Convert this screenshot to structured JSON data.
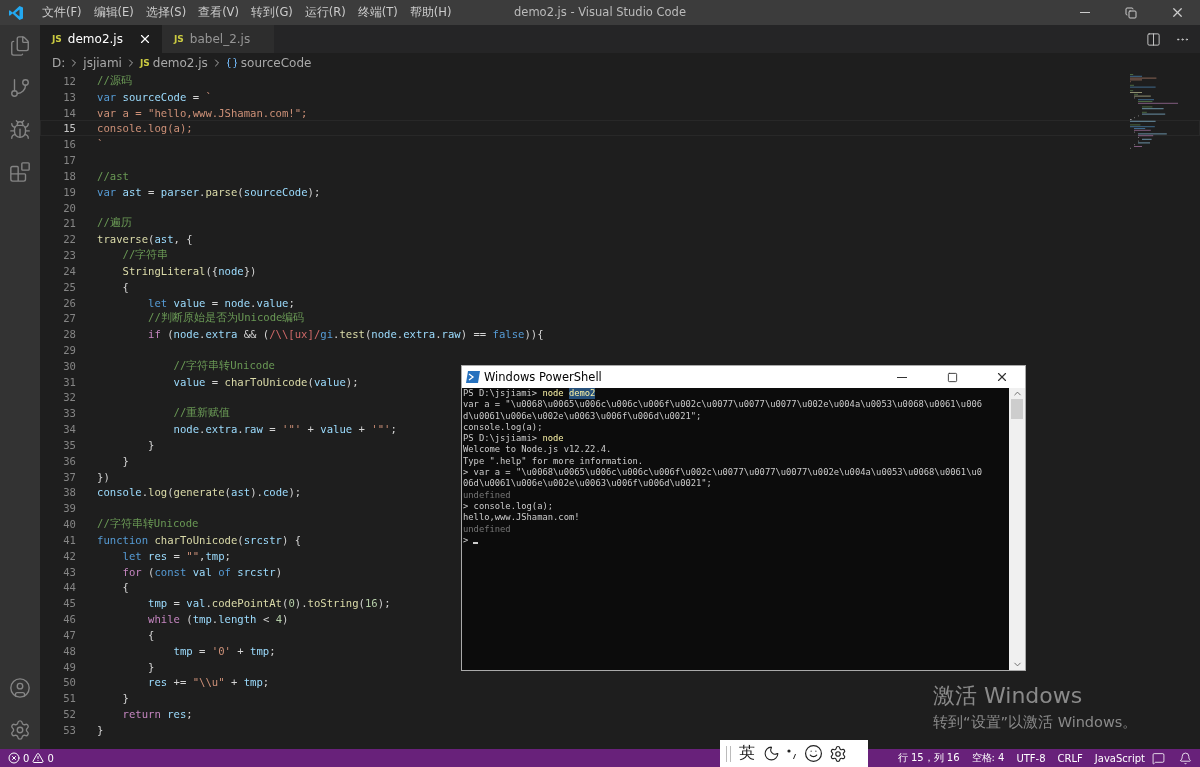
{
  "window": {
    "title": "demo2.js - Visual Studio Code"
  },
  "menu": [
    "文件(F)",
    "编辑(E)",
    "选择(S)",
    "查看(V)",
    "转到(G)",
    "运行(R)",
    "终端(T)",
    "帮助(H)"
  ],
  "tabs": [
    {
      "badge": "JS",
      "label": "demo2.js",
      "selected": true
    },
    {
      "badge": "JS",
      "label": "babel_2.js",
      "selected": false
    }
  ],
  "breadcrumb": {
    "drive": "D:",
    "folder": "jsjiami",
    "file_badge": "JS",
    "file": "demo2.js",
    "symbol": "sourceCode"
  },
  "editor": {
    "lines": [
      {
        "number": "12",
        "current": false,
        "tokens": [
          {
            "text": "//源码",
            "kind": "comment"
          }
        ]
      },
      {
        "number": "13",
        "current": false,
        "tokens": [
          {
            "text": "var",
            "kind": "keyword"
          },
          {
            "text": " sourceCode",
            "kind": "variable"
          },
          {
            "text": " = ",
            "kind": "plain"
          },
          {
            "text": "`",
            "kind": "string"
          }
        ]
      },
      {
        "number": "14",
        "current": false,
        "tokens": [
          {
            "text": "var a = \"hello,www.JShaman.com!\";",
            "kind": "string"
          }
        ]
      },
      {
        "number": "15",
        "current": true,
        "tokens": [
          {
            "text": "console.log(a);",
            "kind": "string"
          }
        ]
      },
      {
        "number": "16",
        "current": false,
        "tokens": [
          {
            "text": "`",
            "kind": "string"
          }
        ]
      },
      {
        "number": "17",
        "current": false
      },
      {
        "number": "18",
        "current": false,
        "tokens": [
          {
            "text": "//ast",
            "kind": "comment"
          }
        ]
      },
      {
        "number": "19",
        "current": false,
        "tokens": [
          {
            "text": "var",
            "kind": "keyword"
          },
          {
            "text": " ast",
            "kind": "variable"
          },
          {
            "text": " = ",
            "kind": "plain"
          },
          {
            "text": "parser",
            "kind": "variable"
          },
          {
            "text": ".",
            "kind": "plain"
          },
          {
            "text": "parse",
            "kind": "function"
          },
          {
            "text": "(",
            "kind": "plain"
          },
          {
            "text": "sourceCode",
            "kind": "variable"
          },
          {
            "text": ");",
            "kind": "plain"
          }
        ]
      },
      {
        "number": "20",
        "current": false
      },
      {
        "number": "21",
        "current": false,
        "tokens": [
          {
            "text": "//遍历",
            "kind": "comment"
          }
        ]
      },
      {
        "number": "22",
        "current": false,
        "tokens": [
          {
            "text": "traverse",
            "kind": "function"
          },
          {
            "text": "(",
            "kind": "plain"
          },
          {
            "text": "ast",
            "kind": "variable"
          },
          {
            "text": ", {",
            "kind": "plain"
          }
        ]
      },
      {
        "number": "23",
        "current": false,
        "tokens": [
          {
            "text": "    //字符串",
            "kind": "comment"
          }
        ]
      },
      {
        "number": "24",
        "current": false,
        "tokens": [
          {
            "text": "    StringLiteral",
            "kind": "function"
          },
          {
            "text": "({",
            "kind": "plain"
          },
          {
            "text": "node",
            "kind": "variable"
          },
          {
            "text": "})",
            "kind": "plain"
          }
        ]
      },
      {
        "number": "25",
        "current": false,
        "tokens": [
          {
            "text": "    {",
            "kind": "plain"
          }
        ]
      },
      {
        "number": "26",
        "current": false,
        "tokens": [
          {
            "text": "        let",
            "kind": "keyword"
          },
          {
            "text": " value",
            "kind": "variable"
          },
          {
            "text": " = ",
            "kind": "plain"
          },
          {
            "text": "node",
            "kind": "variable"
          },
          {
            "text": ".",
            "kind": "plain"
          },
          {
            "text": "value",
            "kind": "variable"
          },
          {
            "text": ";",
            "kind": "plain"
          }
        ]
      },
      {
        "number": "27",
        "current": false,
        "tokens": [
          {
            "text": "        //判断原始是否为Unicode编码",
            "kind": "comment"
          }
        ]
      },
      {
        "number": "28",
        "current": false,
        "tokens": [
          {
            "text": "        if",
            "kind": "control"
          },
          {
            "text": " (",
            "kind": "plain"
          },
          {
            "text": "node",
            "kind": "variable"
          },
          {
            "text": ".",
            "kind": "plain"
          },
          {
            "text": "extra",
            "kind": "variable"
          },
          {
            "text": " && (",
            "kind": "plain"
          },
          {
            "text": "/\\\\[ux]/",
            "kind": "regex"
          },
          {
            "text": "gi",
            "kind": "keyword"
          },
          {
            "text": ".",
            "kind": "plain"
          },
          {
            "text": "test",
            "kind": "function"
          },
          {
            "text": "(",
            "kind": "plain"
          },
          {
            "text": "node",
            "kind": "variable"
          },
          {
            "text": ".",
            "kind": "plain"
          },
          {
            "text": "extra",
            "kind": "variable"
          },
          {
            "text": ".",
            "kind": "plain"
          },
          {
            "text": "raw",
            "kind": "variable"
          },
          {
            "text": ") == ",
            "kind": "plain"
          },
          {
            "text": "false",
            "kind": "keyword"
          },
          {
            "text": ")){",
            "kind": "plain"
          }
        ]
      },
      {
        "number": "29",
        "current": false
      },
      {
        "number": "30",
        "current": false,
        "tokens": [
          {
            "text": "            //字符串转Unicode",
            "kind": "comment"
          }
        ]
      },
      {
        "number": "31",
        "current": false,
        "tokens": [
          {
            "text": "            value",
            "kind": "variable"
          },
          {
            "text": " = ",
            "kind": "plain"
          },
          {
            "text": "charToUnicode",
            "kind": "function"
          },
          {
            "text": "(",
            "kind": "plain"
          },
          {
            "text": "value",
            "kind": "variable"
          },
          {
            "text": ");",
            "kind": "plain"
          }
        ]
      },
      {
        "number": "32",
        "current": false
      },
      {
        "number": "33",
        "current": false,
        "tokens": [
          {
            "text": "            //重新赋值",
            "kind": "comment"
          }
        ]
      },
      {
        "number": "34",
        "current": false,
        "tokens": [
          {
            "text": "            node",
            "kind": "variable"
          },
          {
            "text": ".",
            "kind": "plain"
          },
          {
            "text": "extra",
            "kind": "variable"
          },
          {
            "text": ".",
            "kind": "plain"
          },
          {
            "text": "raw",
            "kind": "variable"
          },
          {
            "text": " = ",
            "kind": "plain"
          },
          {
            "text": "'\"'",
            "kind": "string"
          },
          {
            "text": " + ",
            "kind": "plain"
          },
          {
            "text": "value",
            "kind": "variable"
          },
          {
            "text": " + ",
            "kind": "plain"
          },
          {
            "text": "'\"'",
            "kind": "string"
          },
          {
            "text": ";",
            "kind": "plain"
          }
        ]
      },
      {
        "number": "35",
        "current": false,
        "tokens": [
          {
            "text": "        }",
            "kind": "plain"
          }
        ]
      },
      {
        "number": "36",
        "current": false,
        "tokens": [
          {
            "text": "    }",
            "kind": "plain"
          }
        ]
      },
      {
        "number": "37",
        "current": false,
        "tokens": [
          {
            "text": "})",
            "kind": "plain"
          }
        ]
      },
      {
        "number": "38",
        "current": false,
        "tokens": [
          {
            "text": "console",
            "kind": "variable"
          },
          {
            "text": ".",
            "kind": "plain"
          },
          {
            "text": "log",
            "kind": "function"
          },
          {
            "text": "(",
            "kind": "plain"
          },
          {
            "text": "generate",
            "kind": "function"
          },
          {
            "text": "(",
            "kind": "plain"
          },
          {
            "text": "ast",
            "kind": "variable"
          },
          {
            "text": ").",
            "kind": "plain"
          },
          {
            "text": "code",
            "kind": "variable"
          },
          {
            "text": ");",
            "kind": "plain"
          }
        ]
      },
      {
        "number": "39",
        "current": false
      },
      {
        "number": "40",
        "current": false,
        "tokens": [
          {
            "text": "//字符串转Unicode",
            "kind": "comment"
          }
        ]
      },
      {
        "number": "41",
        "current": false,
        "tokens": [
          {
            "text": "function",
            "kind": "keyword"
          },
          {
            "text": " charToUnicode",
            "kind": "function"
          },
          {
            "text": "(",
            "kind": "plain"
          },
          {
            "text": "srcstr",
            "kind": "variable"
          },
          {
            "text": ") {",
            "kind": "plain"
          }
        ]
      },
      {
        "number": "42",
        "current": false,
        "tokens": [
          {
            "text": "    let",
            "kind": "keyword"
          },
          {
            "text": " res",
            "kind": "variable"
          },
          {
            "text": " = ",
            "kind": "plain"
          },
          {
            "text": "\"\"",
            "kind": "string"
          },
          {
            "text": ",",
            "kind": "plain"
          },
          {
            "text": "tmp",
            "kind": "variable"
          },
          {
            "text": ";",
            "kind": "plain"
          }
        ]
      },
      {
        "number": "43",
        "current": false,
        "tokens": [
          {
            "text": "    for",
            "kind": "control"
          },
          {
            "text": " (",
            "kind": "plain"
          },
          {
            "text": "const",
            "kind": "keyword"
          },
          {
            "text": " val",
            "kind": "variable"
          },
          {
            "text": " of",
            "kind": "keyword"
          },
          {
            "text": " srcstr",
            "kind": "variable"
          },
          {
            "text": ")",
            "kind": "plain"
          }
        ]
      },
      {
        "number": "44",
        "current": false,
        "tokens": [
          {
            "text": "    {",
            "kind": "plain"
          }
        ]
      },
      {
        "number": "45",
        "current": false,
        "tokens": [
          {
            "text": "        tmp",
            "kind": "variable"
          },
          {
            "text": " = ",
            "kind": "plain"
          },
          {
            "text": "val",
            "kind": "variable"
          },
          {
            "text": ".",
            "kind": "plain"
          },
          {
            "text": "codePointAt",
            "kind": "function"
          },
          {
            "text": "(",
            "kind": "plain"
          },
          {
            "text": "0",
            "kind": "number"
          },
          {
            "text": ").",
            "kind": "plain"
          },
          {
            "text": "toString",
            "kind": "function"
          },
          {
            "text": "(",
            "kind": "plain"
          },
          {
            "text": "16",
            "kind": "number"
          },
          {
            "text": ");",
            "kind": "plain"
          }
        ]
      },
      {
        "number": "46",
        "current": false,
        "tokens": [
          {
            "text": "        while",
            "kind": "control"
          },
          {
            "text": " (",
            "kind": "plain"
          },
          {
            "text": "tmp",
            "kind": "variable"
          },
          {
            "text": ".",
            "kind": "plain"
          },
          {
            "text": "length",
            "kind": "variable"
          },
          {
            "text": " < ",
            "kind": "plain"
          },
          {
            "text": "4",
            "kind": "number"
          },
          {
            "text": ")",
            "kind": "plain"
          }
        ]
      },
      {
        "number": "47",
        "current": false,
        "tokens": [
          {
            "text": "        {",
            "kind": "plain"
          }
        ]
      },
      {
        "number": "48",
        "current": false,
        "tokens": [
          {
            "text": "            tmp",
            "kind": "variable"
          },
          {
            "text": " = ",
            "kind": "plain"
          },
          {
            "text": "'0'",
            "kind": "string"
          },
          {
            "text": " + ",
            "kind": "plain"
          },
          {
            "text": "tmp",
            "kind": "variable"
          },
          {
            "text": ";",
            "kind": "plain"
          }
        ]
      },
      {
        "number": "49",
        "current": false,
        "tokens": [
          {
            "text": "        }",
            "kind": "plain"
          }
        ]
      },
      {
        "number": "50",
        "current": false,
        "tokens": [
          {
            "text": "        res",
            "kind": "variable"
          },
          {
            "text": " += ",
            "kind": "plain"
          },
          {
            "text": "\"\\\\u\"",
            "kind": "string"
          },
          {
            "text": " + ",
            "kind": "plain"
          },
          {
            "text": "tmp",
            "kind": "variable"
          },
          {
            "text": ";",
            "kind": "plain"
          }
        ]
      },
      {
        "number": "51",
        "current": false,
        "tokens": [
          {
            "text": "    }",
            "kind": "plain"
          }
        ]
      },
      {
        "number": "52",
        "current": false,
        "tokens": [
          {
            "text": "    return",
            "kind": "control"
          },
          {
            "text": " res",
            "kind": "variable"
          },
          {
            "text": ";",
            "kind": "plain"
          }
        ]
      },
      {
        "number": "53",
        "current": false,
        "tokens": [
          {
            "text": "}",
            "kind": "plain"
          }
        ]
      }
    ]
  },
  "terminal": {
    "title": "Windows PowerShell",
    "lines": [
      [
        {
          "text": "PS D:\\jsjiami> ",
          "kind": "out"
        },
        {
          "text": "node ",
          "kind": "cmd"
        },
        {
          "text": "demo2",
          "kind": "selected"
        }
      ],
      [
        {
          "text": "var a = \"\\u0068\\u0065\\u006c\\u006c\\u006f\\u002c\\u0077\\u0077\\u0077\\u002e\\u004a\\u0053\\u0068\\u0061\\u006",
          "kind": "out"
        }
      ],
      [
        {
          "text": "d\\u0061\\u006e\\u002e\\u0063\\u006f\\u006d\\u0021\";",
          "kind": "out"
        }
      ],
      [
        {
          "text": "console.log(a);",
          "kind": "out"
        }
      ],
      [
        {
          "text": "PS D:\\jsjiami> ",
          "kind": "out"
        },
        {
          "text": "node",
          "kind": "cmd"
        }
      ],
      [
        {
          "text": "Welcome to Node.js v12.22.4.",
          "kind": "out"
        }
      ],
      [
        {
          "text": "Type \".help\" for more information.",
          "kind": "out"
        }
      ],
      [
        {
          "text": "> var a = \"\\u0068\\u0065\\u006c\\u006c\\u006f\\u002c\\u0077\\u0077\\u0077\\u002e\\u004a\\u0053\\u0068\\u0061\\u0",
          "kind": "out"
        }
      ],
      [
        {
          "text": "06d\\u0061\\u006e\\u002e\\u0063\\u006f\\u006d\\u0021\";",
          "kind": "out"
        }
      ],
      [
        {
          "text": "undefined",
          "kind": "dim"
        }
      ],
      [
        {
          "text": "> console.log(a);",
          "kind": "out"
        }
      ],
      [
        {
          "text": "hello,www.JShaman.com!",
          "kind": "out"
        }
      ],
      [
        {
          "text": "undefined",
          "kind": "dim"
        }
      ],
      [
        {
          "text": ">",
          "kind": "out"
        }
      ]
    ]
  },
  "activation_notice": {
    "title": "激活 Windows",
    "message": "转到“设置”以激活 Windows。"
  },
  "ime_toolbar": {
    "mode": "英"
  },
  "status_bar": {
    "errors": "0",
    "warnings": "0",
    "items": [
      "行 15，列 16",
      "空格: 4",
      "UTF-8",
      "CRLF",
      "JavaScript"
    ]
  }
}
